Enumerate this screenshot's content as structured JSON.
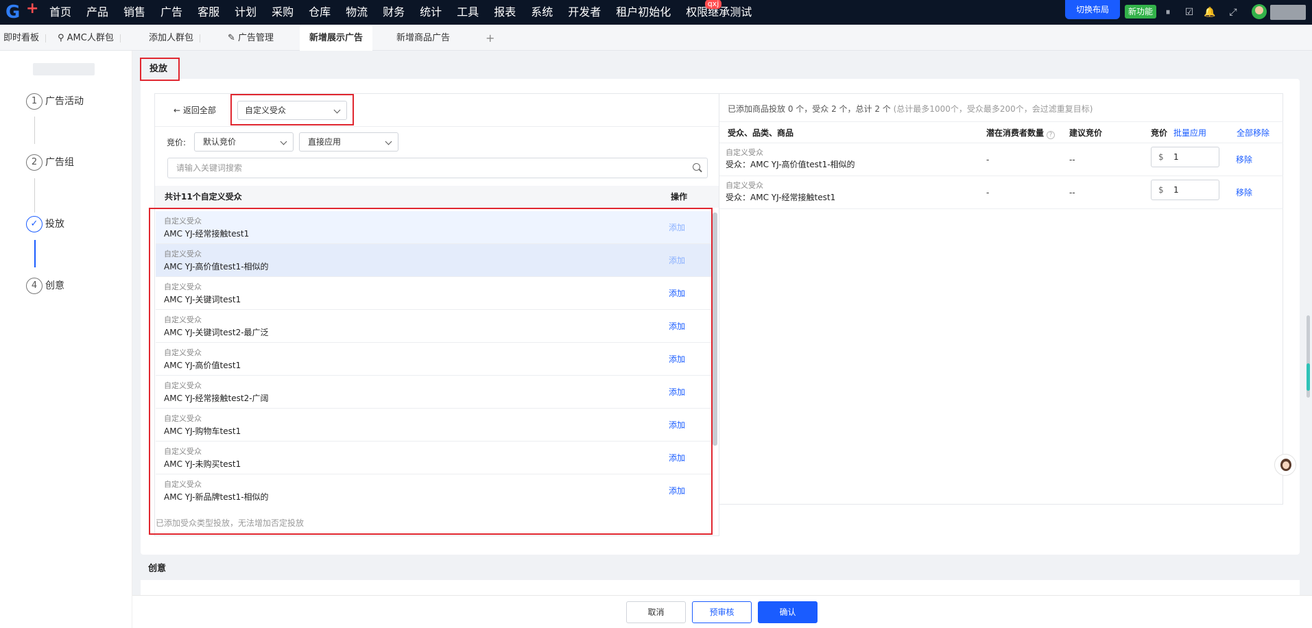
{
  "nav": {
    "items": [
      "首页",
      "产品",
      "销售",
      "广告",
      "客服",
      "计划",
      "采购",
      "仓库",
      "物流",
      "财务",
      "统计",
      "工具",
      "报表",
      "系统",
      "开发者",
      "租户初始化",
      "权限继承测试"
    ],
    "badge": "qxj",
    "switch_layout": "切换布局",
    "new_feature": "新功能"
  },
  "tabs": [
    "即时看板",
    "AMC人群包",
    "添加人群包",
    "广告管理",
    "新增展示广告",
    "新增商品广告"
  ],
  "steps": [
    {
      "num": "1",
      "label": "广告活动"
    },
    {
      "num": "2",
      "label": "广告组"
    },
    {
      "num": "✓",
      "label": "投放"
    },
    {
      "num": "4",
      "label": "创意"
    }
  ],
  "section": {
    "title": "投放"
  },
  "left": {
    "back_label": "返回全部",
    "audience_select": "自定义受众",
    "bid_label": "竞价:",
    "bid_select": "默认竞价",
    "apply_select": "直接应用",
    "search_placeholder": "请输入关键词搜索",
    "list_title": "共计11个自定义受众",
    "action_header": "操作",
    "rows": [
      {
        "type": "自定义受众",
        "name": "AMC YJ-经常接触test1",
        "action": "添加"
      },
      {
        "type": "自定义受众",
        "name": "AMC YJ-高价值test1-相似的",
        "action": "添加"
      },
      {
        "type": "自定义受众",
        "name": "AMC YJ-关键词test1",
        "action": "添加"
      },
      {
        "type": "自定义受众",
        "name": "AMC YJ-关键词test2-最广泛",
        "action": "添加"
      },
      {
        "type": "自定义受众",
        "name": "AMC YJ-高价值test1",
        "action": "添加"
      },
      {
        "type": "自定义受众",
        "name": "AMC YJ-经常接触test2-广阔",
        "action": "添加"
      },
      {
        "type": "自定义受众",
        "name": "AMC YJ-购物车test1",
        "action": "添加"
      },
      {
        "type": "自定义受众",
        "name": "AMC YJ-未购买test1",
        "action": "添加"
      },
      {
        "type": "自定义受众",
        "name": "AMC YJ-新品牌test1-相似的",
        "action": "添加"
      }
    ],
    "note": "已添加受众类型投放，无法增加否定投放"
  },
  "right": {
    "summary_main": "已添加商品投放 0 个，受众 2 个，总计 2 个",
    "summary_hint": "(总计最多1000个，受众最多200个，会过滤重复目标)",
    "headers": {
      "target": "受众、品类、商品",
      "potential": "潜在消费者数量",
      "suggested": "建议竞价",
      "bid": "竞价",
      "batch_apply": "批量应用",
      "remove_all": "全部移除"
    },
    "rows": [
      {
        "type": "自定义受众",
        "name": "受众：AMC YJ-高价值test1-相似的",
        "potential": "-",
        "suggested": "--",
        "currency": "$",
        "bid": "1",
        "remove": "移除"
      },
      {
        "type": "自定义受众",
        "name": "受众：AMC YJ-经常接触test1",
        "potential": "-",
        "suggested": "--",
        "currency": "$",
        "bid": "1",
        "remove": "移除"
      }
    ]
  },
  "creative": {
    "title": "创意"
  },
  "footer": {
    "cancel": "取消",
    "precheck": "预审核",
    "confirm": "确认"
  },
  "colors": {
    "accent": "#1a5cff",
    "highlight_border": "#e0262f",
    "nav_bg": "#0b1526",
    "new_feature": "#33b24a"
  }
}
